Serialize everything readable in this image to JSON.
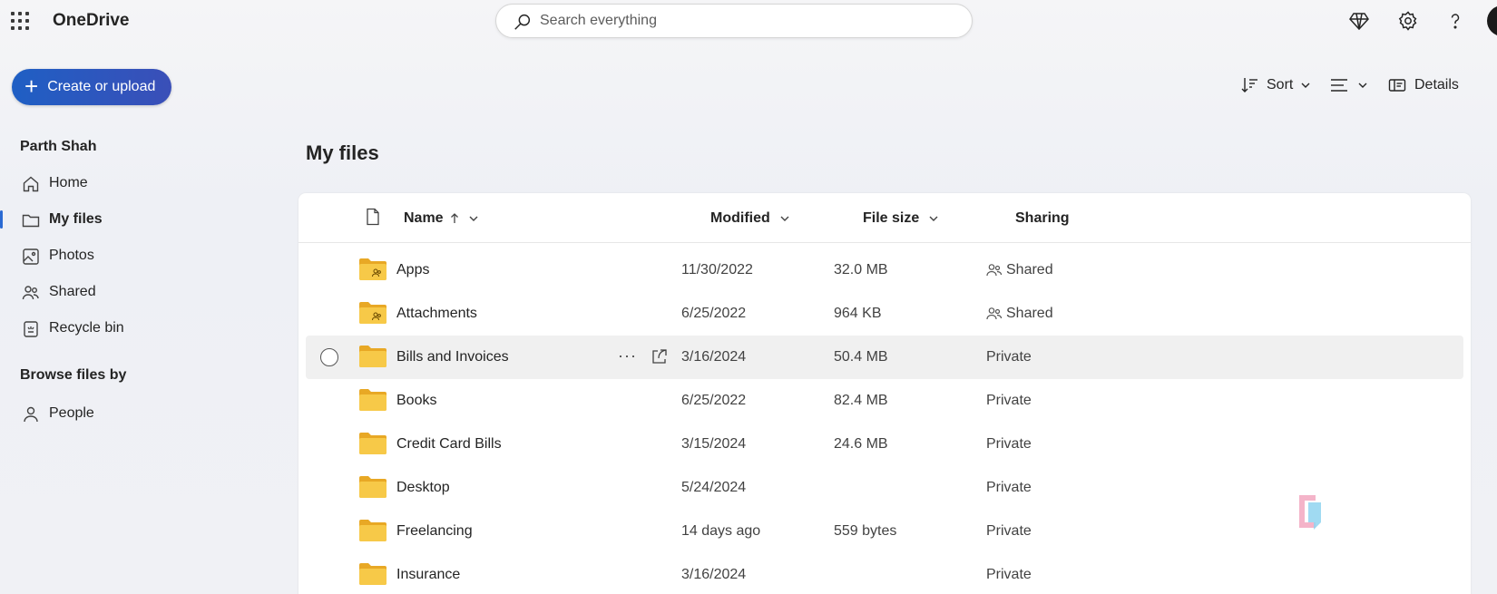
{
  "app": {
    "title": "OneDrive"
  },
  "search": {
    "placeholder": "Search everything"
  },
  "create_button": {
    "label": "Create or upload"
  },
  "toolbar": {
    "sort_label": "Sort",
    "details_label": "Details"
  },
  "sidebar": {
    "user_name": "Parth Shah",
    "items": [
      {
        "label": "Home",
        "icon": "home-icon"
      },
      {
        "label": "My files",
        "icon": "folder-icon",
        "active": true
      },
      {
        "label": "Photos",
        "icon": "image-icon"
      },
      {
        "label": "Shared",
        "icon": "people-icon"
      },
      {
        "label": "Recycle bin",
        "icon": "recycle-bin-icon"
      }
    ],
    "browse_heading": "Browse files by",
    "browse_items": [
      {
        "label": "People",
        "icon": "person-icon"
      }
    ]
  },
  "main": {
    "title": "My files",
    "columns": {
      "name": "Name",
      "modified": "Modified",
      "file_size": "File size",
      "sharing": "Sharing"
    },
    "rows": [
      {
        "name": "Apps",
        "modified": "11/30/2022",
        "size": "32.0 MB",
        "sharing": "Shared",
        "shared_folder": true
      },
      {
        "name": "Attachments",
        "modified": "6/25/2022",
        "size": "964 KB",
        "sharing": "Shared",
        "shared_folder": true
      },
      {
        "name": "Bills and Invoices",
        "modified": "3/16/2024",
        "size": "50.4 MB",
        "sharing": "Private",
        "hovered": true
      },
      {
        "name": "Books",
        "modified": "6/25/2022",
        "size": "82.4 MB",
        "sharing": "Private"
      },
      {
        "name": "Credit Card Bills",
        "modified": "3/15/2024",
        "size": "24.6 MB",
        "sharing": "Private"
      },
      {
        "name": "Desktop",
        "modified": "5/24/2024",
        "size": "",
        "sharing": "Private"
      },
      {
        "name": "Freelancing",
        "modified": "14 days ago",
        "size": "559 bytes",
        "sharing": "Private"
      },
      {
        "name": "Insurance",
        "modified": "3/16/2024",
        "size": "",
        "sharing": "Private"
      }
    ]
  },
  "watermark": {
    "text": "XDA"
  },
  "colors": {
    "accent": "#2a6ad3",
    "folder": "#f7c948",
    "folder_dark": "#e8a825",
    "create_button": "#2a5bc4"
  }
}
